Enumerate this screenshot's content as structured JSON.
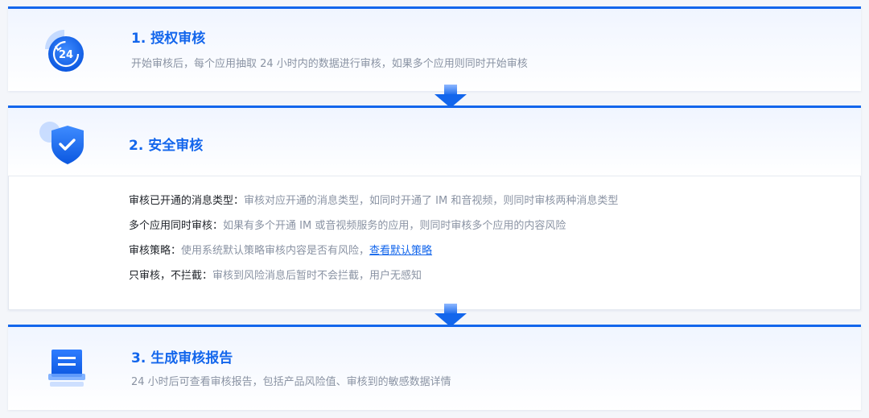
{
  "steps": [
    {
      "title": "1. 授权审核",
      "description": "开始审核后，每个应用抽取 24 小时内的数据进行审核，如果多个应用则同时开始审核",
      "icon": "clock-24-icon"
    },
    {
      "title": "2. 安全审核",
      "icon": "shield-check-icon",
      "features": [
        {
          "label": "审核已开通的消息类型：",
          "text": "审核对应开通的消息类型，如同时开通了 IM 和音视频，则同时审核两种消息类型"
        },
        {
          "label": "多个应用同时审核：",
          "text": "如果有多个开通 IM 或音视频服务的应用，则同时审核多个应用的内容风险"
        },
        {
          "label": "审核策略：",
          "text": "使用系统默认策略审核内容是否有风险，",
          "link": "查看默认策略"
        },
        {
          "label": "只审核，不拦截：",
          "text": "审核到风险消息后暂时不会拦截，用户无感知"
        }
      ]
    },
    {
      "title": "3. 生成审核报告",
      "description": "24 小时后可查看审核报告，包括产品风险值、审核到的敏感数据详情",
      "icon": "report-document-icon"
    }
  ],
  "colors": {
    "accent": "#1366ec",
    "muted_text": "#8a93a3",
    "label_text": "#1f2329"
  }
}
